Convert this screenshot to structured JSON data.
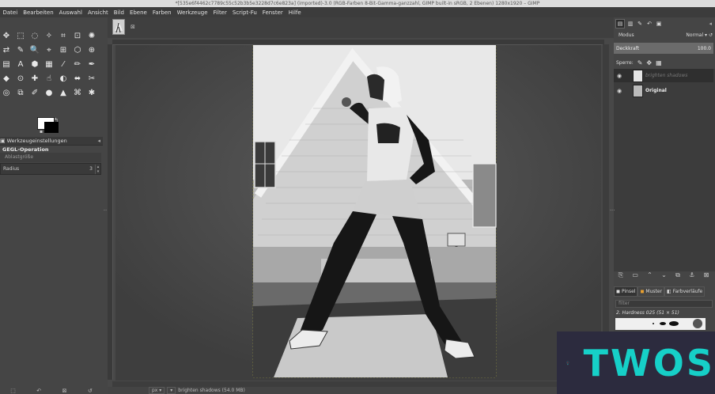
{
  "window": {
    "title": "*[535e6f4462c7789c55c52b3b5e3228d7c6e823a] (imported)-3.0 (RGB-Farben 8-Bit-Gamma-ganzzahl, GIMP built-in sRGB, 2 Ebenen) 1280x1920 – GIMP"
  },
  "menu": {
    "items": [
      "Datei",
      "Bearbeiten",
      "Auswahl",
      "Ansicht",
      "Bild",
      "Ebene",
      "Farben",
      "Werkzeuge",
      "Filter",
      "Script-Fu",
      "Fenster",
      "Hilfe"
    ]
  },
  "toolbox": {
    "tools": [
      "move-tool",
      "rect-select-tool",
      "lasso-tool",
      "fuzzy-select-tool",
      "crop-tool",
      "unified-transform-tool",
      "warp-tool",
      "flip-tool",
      "path-tool",
      "zoom-tool",
      "measure-tool",
      "align-tool",
      "cage-tool",
      "handle-transform-tool",
      "fill-tool",
      "text-tool",
      "bucket-fill-tool",
      "gradient-tool",
      "paintbrush-tool",
      "pencil-tool",
      "airbrush-tool",
      "ink-tool",
      "clone-tool",
      "heal-tool",
      "smudge-tool",
      "dodge-tool",
      "color-picker-tool",
      "scissors-tool",
      "foreground-select-tool",
      "perspective-clone-tool",
      "mypaint-brush-tool",
      "blur-tool",
      "sharpen-tool",
      "paths-tool",
      "text-edit-tool"
    ],
    "tool_glyphs": [
      "✥",
      "⬚",
      "◌",
      "✧",
      "⌗",
      "⊡",
      "✺",
      "⇄",
      "✎",
      "🔍",
      "⌖",
      "⊞",
      "⬡",
      "⊕",
      "▤",
      "A",
      "⬢",
      "▦",
      "⁄",
      "✏",
      "✒",
      "◆",
      "⊙",
      "✚",
      "☝",
      "◐",
      "⬌",
      "✂",
      "◎",
      "⧉",
      "✐",
      "●",
      "▲",
      "⌘",
      "✱"
    ],
    "options_tab_label": "Werkzeugeinstellungen",
    "gegl_label": "GEGL-Operation",
    "preset_placeholder": "Ablastgröße",
    "radius_label": "Radius",
    "radius_value": "3"
  },
  "image": {
    "zoom": "",
    "status_text": "brighten shadows (54.0 MB)"
  },
  "layers_panel": {
    "mode_label": "Modus",
    "mode_value": "Normal",
    "opacity_label": "Deckkraft",
    "opacity_value": "100.0",
    "lock_label": "Sperre:",
    "layers": [
      {
        "name": "brighten shadows",
        "visible": true,
        "active": true
      },
      {
        "name": "Original",
        "visible": true,
        "active": false
      }
    ]
  },
  "brushes_panel": {
    "tabs": [
      "Pinsel",
      "Muster",
      "Farbverläufe"
    ],
    "filter_placeholder": "filter",
    "brush_name": "2. Hardness 025 (51 × 51)"
  },
  "ad": {
    "word": "TWOS",
    "accent": "#16d0c8"
  }
}
